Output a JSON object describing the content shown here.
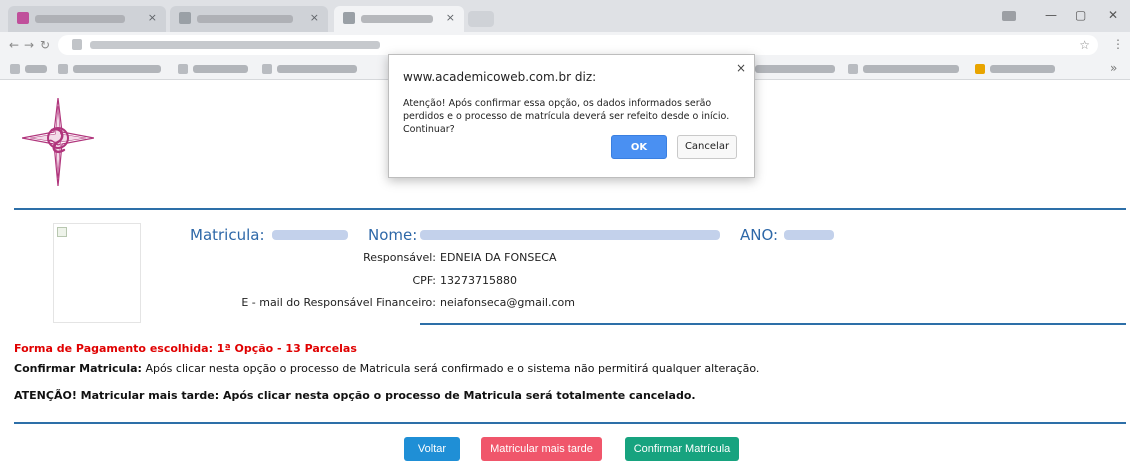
{
  "browser": {
    "window_controls": {
      "minimize": "—",
      "maximize": "▢",
      "close": "✕"
    },
    "tab_close_glyph": "×",
    "bookmark_star": "☆",
    "menu_glyph": "⋮"
  },
  "dialog": {
    "title": "www.academicoweb.com.br diz:",
    "message": "Atenção! Após confirmar essa opção, os dados informados serão perdidos e o processo de matrícula deverá ser refeito desde o início. Continuar?",
    "ok_label": "OK",
    "cancel_label": "Cancelar",
    "close_glyph": "×"
  },
  "student": {
    "matricula_label": "Matricula:",
    "nome_label": "Nome:",
    "ano_label": "ANO:",
    "responsavel_label": "Responsável:",
    "responsavel_value": "EDNEIA DA FONSECA",
    "cpf_label": "CPF:",
    "cpf_value": "13273715880",
    "email_label": "E - mail do Responsável Financeiro:",
    "email_value": "neiafonseca@gmail.com"
  },
  "notices": {
    "payment": "Forma de Pagamento escolhida: 1ª Opção - 13 Parcelas",
    "confirm_bold": "Confirmar Matricula:",
    "confirm_text": " Após clicar nesta opção o processo de Matricula será confirmado e o sistema não permitirá qualquer alteração.",
    "warning": "ATENÇÃO! Matricular mais tarde: Após clicar nesta opção o processo de Matricula será totalmente cancelado."
  },
  "buttons": {
    "voltar": "Voltar",
    "matricular_tarde": "Matricular mais tarde",
    "confirmar": "Confirmar Matrícula"
  },
  "colors": {
    "accent_blue": "#2e68a8",
    "payment_red": "#e00000",
    "voltar_blue": "#1f8fd6",
    "later_pink": "#f0566b",
    "confirm_green": "#17a37f",
    "logo_magenta": "#b0357c"
  }
}
